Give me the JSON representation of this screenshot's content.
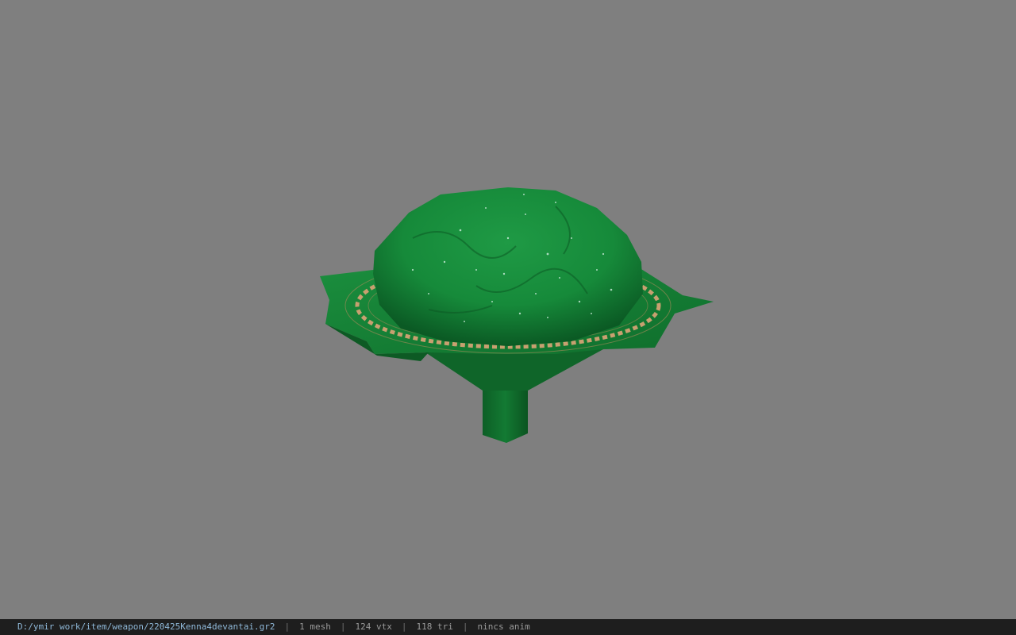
{
  "viewer": {
    "background_color": "#7f7f7f",
    "model_name": "220425Kenna4devantai.gr2",
    "model_colors": {
      "dome": "#1a8a3a",
      "dome_dark": "#0d5f26",
      "brim": "#168a3a",
      "trim": "#c8a070",
      "stem": "#0f6a2a"
    }
  },
  "status": {
    "path": "D:/ymir work/item/weapon/220425Kenna4devantai.gr2",
    "mesh": "1 mesh",
    "vtx": "124 vtx",
    "tri": "118 tri",
    "anim": "nincs anim",
    "separator": "|"
  }
}
